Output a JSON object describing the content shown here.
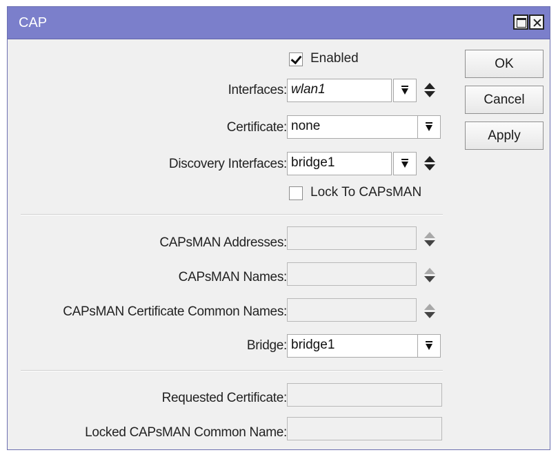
{
  "window": {
    "title": "CAP"
  },
  "enabled": {
    "label": "Enabled",
    "checked": true
  },
  "interfaces": {
    "label": "Interfaces:",
    "value": "wlan1"
  },
  "certificate": {
    "label": "Certificate:",
    "value": "none"
  },
  "discovery_interfaces": {
    "label": "Discovery Interfaces:",
    "value": "bridge1"
  },
  "lock_to_capsman": {
    "label": "Lock To CAPsMAN",
    "checked": false
  },
  "capsman_addresses": {
    "label": "CAPsMAN Addresses:",
    "value": ""
  },
  "capsman_names": {
    "label": "CAPsMAN Names:",
    "value": ""
  },
  "capsman_cert_common_names": {
    "label": "CAPsMAN Certificate Common Names:",
    "value": ""
  },
  "bridge": {
    "label": "Bridge:",
    "value": "bridge1"
  },
  "requested_certificate": {
    "label": "Requested Certificate:",
    "value": ""
  },
  "locked_capsman_common_name": {
    "label": "Locked CAPsMAN Common Name:",
    "value": ""
  },
  "buttons": {
    "ok": "OK",
    "cancel": "Cancel",
    "apply": "Apply"
  },
  "icons": {
    "maximize": "maximize-icon",
    "close": "close-icon",
    "dropdown": "dropdown-arrow-icon",
    "updown": "up-down-arrows-icon"
  },
  "colors": {
    "titlebar": "#7b7fcb",
    "window_bg": "#f0f0f0"
  }
}
